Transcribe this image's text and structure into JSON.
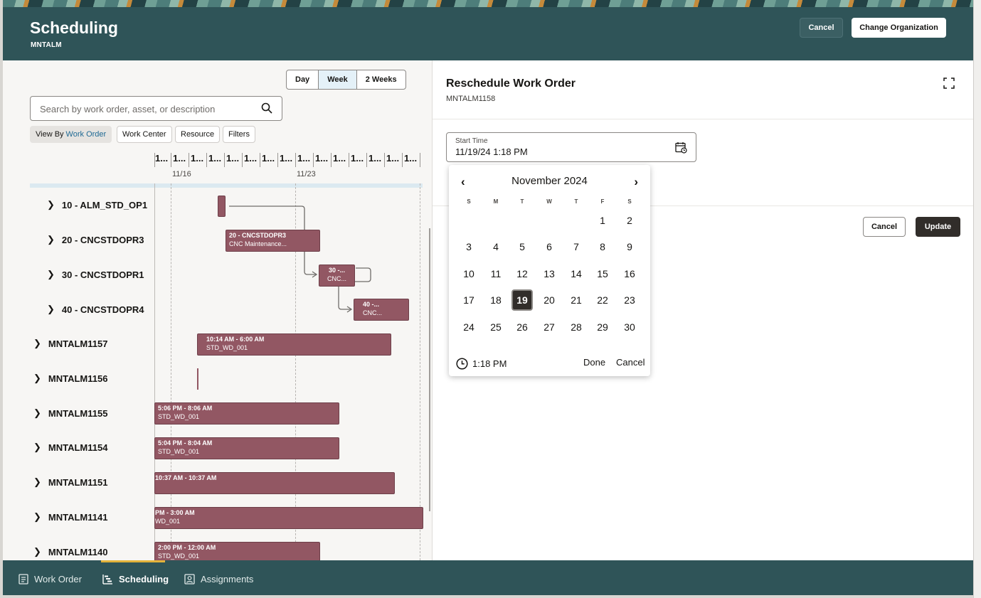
{
  "header": {
    "title": "Scheduling",
    "subtitle": "MNTALM",
    "cancel_label": "Cancel",
    "change_org_label": "Change Organization"
  },
  "view": {
    "day": "Day",
    "week": "Week",
    "two_weeks": "2 Weeks",
    "selected": "Week"
  },
  "search": {
    "placeholder": "Search by work order, asset, or description"
  },
  "chips": {
    "view_by_prefix": "View By",
    "view_by_value": "Work Order",
    "work_center": "Work Center",
    "resource": "Resource",
    "filters": "Filters"
  },
  "timeline": {
    "tick_label": "1...",
    "date1": "11/16",
    "date2": "11/23"
  },
  "rows": [
    {
      "label": "10 - ALM_STD_OP1"
    },
    {
      "label": "20 - CNCSTDOPR3"
    },
    {
      "label": "30 - CNCSTDOPR1"
    },
    {
      "label": "40 - CNCSTDOPR4"
    },
    {
      "label": "MNTALM1157"
    },
    {
      "label": "MNTALM1156"
    },
    {
      "label": "MNTALM1155"
    },
    {
      "label": "MNTALM1154"
    },
    {
      "label": "MNTALM1151"
    },
    {
      "label": "MNTALM1141"
    },
    {
      "label": "MNTALM1140"
    }
  ],
  "bars": {
    "b20_l1": "20 - CNCSTDOPR3",
    "b20_l2": "CNC Maintenance...",
    "b30_l1": "30 -...",
    "b30_l2": "CNC...",
    "b40_l1": "40 -...",
    "b40_l2": "CNC...",
    "b1157_l1": "10:14 AM - 6:00 AM",
    "b1157_l2": "STD_WD_001",
    "b1155_l1": "5:06 PM - 8:06 AM",
    "b1155_l2": "STD_WD_001",
    "b1154_l1": "5:04 PM - 8:04 AM",
    "b1154_l2": "STD_WD_001",
    "b1151_l1": "10:37 AM - 10:37 AM",
    "b1141_l1": "PM - 3:00 AM",
    "b1141_l2": "WD_001",
    "b1140_l1": "2:00 PM - 12:00 AM",
    "b1140_l2": "STD_WD_001"
  },
  "panel": {
    "title": "Reschedule Work Order",
    "subtitle": "MNTALM1158",
    "start_label": "Start Time",
    "start_value": "11/19/24 1:18 PM",
    "cancel_label": "Cancel",
    "update_label": "Update"
  },
  "picker": {
    "month": "November 2024",
    "dows": [
      "S",
      "M",
      "T",
      "W",
      "T",
      "F",
      "S"
    ],
    "weeks": [
      [
        "",
        "",
        "",
        "",
        "",
        "1",
        "2"
      ],
      [
        "3",
        "4",
        "5",
        "6",
        "7",
        "8",
        "9"
      ],
      [
        "10",
        "11",
        "12",
        "13",
        "14",
        "15",
        "16"
      ],
      [
        "17",
        "18",
        "19",
        "20",
        "21",
        "22",
        "23"
      ],
      [
        "24",
        "25",
        "26",
        "27",
        "28",
        "29",
        "30"
      ]
    ],
    "selected_day": "19",
    "time": "1:18 PM",
    "done_label": "Done",
    "cancel_label": "Cancel"
  },
  "bottom_tabs": {
    "work_order": "Work Order",
    "scheduling": "Scheduling",
    "assignments": "Assignments",
    "active": "Scheduling"
  },
  "colors": {
    "header_bg": "#2f5458",
    "bar": "#925763",
    "selected_day": "#312d2a",
    "tab_indicator": "#e3b33b"
  }
}
